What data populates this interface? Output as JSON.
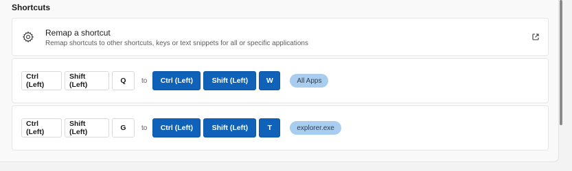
{
  "section": {
    "title": "Shortcuts"
  },
  "remap": {
    "title": "Remap a shortcut",
    "description": "Remap shortcuts to other shortcuts, keys or text snippets for all or specific applications",
    "icon": "gear-icon",
    "link_icon": "external-link-icon"
  },
  "mappings": [
    {
      "from": [
        "Ctrl (Left)",
        "Shift (Left)",
        "Q"
      ],
      "to_label": "to",
      "to": [
        "Ctrl (Left)",
        "Shift (Left)",
        "W"
      ],
      "app": "All Apps"
    },
    {
      "from": [
        "Ctrl (Left)",
        "Shift (Left)",
        "G"
      ],
      "to_label": "to",
      "to": [
        "Ctrl (Left)",
        "Shift (Left)",
        "T"
      ],
      "app": "explorer.exe"
    }
  ],
  "colors": {
    "accent": "#0f62b8",
    "pill": "#a9cdee",
    "background": "#f3f3f3"
  }
}
